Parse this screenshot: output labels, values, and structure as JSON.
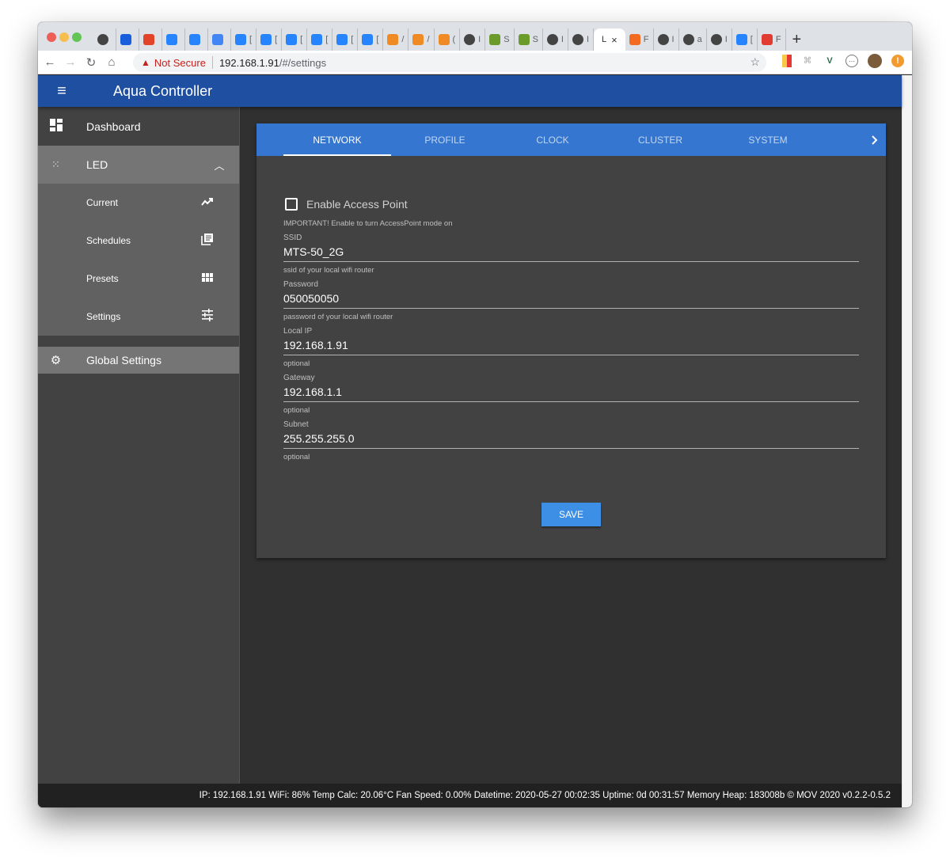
{
  "browser": {
    "tabs": [
      {
        "icon": "globe-icon",
        "label": "",
        "color": "#444444"
      },
      {
        "icon": "bitwarden-icon",
        "label": "",
        "color": "#175ddc"
      },
      {
        "icon": "gitlab-icon",
        "label": "",
        "color": "#e24329"
      },
      {
        "icon": "confluence-icon",
        "label": "",
        "color": "#2684ff"
      },
      {
        "icon": "jira-icon",
        "label": "",
        "color": "#2684ff"
      },
      {
        "icon": "translate-icon",
        "label": "",
        "color": "#4285f4"
      },
      {
        "icon": "jira-icon",
        "label": "[",
        "color": "#2684ff"
      },
      {
        "icon": "jira-icon",
        "label": "[",
        "color": "#2684ff"
      },
      {
        "icon": "jira-icon",
        "label": "[",
        "color": "#2684ff"
      },
      {
        "icon": "jira-icon",
        "label": "[",
        "color": "#2684ff"
      },
      {
        "icon": "jira-icon",
        "label": "[",
        "color": "#2684ff"
      },
      {
        "icon": "jira-icon",
        "label": "[",
        "color": "#2684ff"
      },
      {
        "icon": "box-icon",
        "label": "/",
        "color": "#f08a24"
      },
      {
        "icon": "box-icon",
        "label": "/",
        "color": "#f08a24"
      },
      {
        "icon": "box-icon",
        "label": "(",
        "color": "#f08a24"
      },
      {
        "icon": "globe-icon",
        "label": "I",
        "color": "#444444"
      },
      {
        "icon": "swagger-icon",
        "label": "S",
        "color": "#6b9b2a"
      },
      {
        "icon": "swagger-icon",
        "label": "S",
        "color": "#6b9b2a"
      },
      {
        "icon": "globe-icon",
        "label": "I",
        "color": "#444444"
      },
      {
        "icon": "globe-icon",
        "label": "I",
        "color": "#444444"
      },
      {
        "icon": "",
        "label": "L",
        "color": "",
        "active": true
      },
      {
        "icon": "app-icon",
        "label": "F",
        "color": "#f26b21"
      },
      {
        "icon": "globe-icon",
        "label": "I",
        "color": "#444444"
      },
      {
        "icon": "globe-icon",
        "label": "a",
        "color": "#444444"
      },
      {
        "icon": "globe-icon",
        "label": "I",
        "color": "#444444"
      },
      {
        "icon": "jira-icon",
        "label": "[",
        "color": "#2684ff"
      },
      {
        "icon": "sl-icon",
        "label": "F",
        "color": "#e03c31"
      }
    ],
    "new_tab": "+",
    "security_label": "Not Secure",
    "url_host": "192.168.1.91",
    "url_path": "/#/settings"
  },
  "app": {
    "title": "Aqua Controller"
  },
  "sidebar": {
    "dashboard": "Dashboard",
    "led": "LED",
    "led_items": [
      {
        "label": "Current",
        "icon": "trending-up-icon"
      },
      {
        "label": "Schedules",
        "icon": "library-books-icon"
      },
      {
        "label": "Presets",
        "icon": "grid-icon"
      },
      {
        "label": "Settings",
        "icon": "tune-icon"
      }
    ],
    "global_settings": "Global Settings"
  },
  "settings": {
    "tabs": [
      "NETWORK",
      "PROFILE",
      "CLOCK",
      "CLUSTER",
      "SYSTEM"
    ],
    "active_tab": "NETWORK",
    "enable_ap_label": "Enable Access Point",
    "enable_ap_checked": false,
    "enable_ap_hint": "IMPORTANT! Enable to turn AccessPoint mode on",
    "fields": [
      {
        "label": "SSID",
        "value": "MTS-50_2G",
        "hint": "ssid of your local wifi router"
      },
      {
        "label": "Password",
        "value": "050050050",
        "hint": "password of your local wifi router"
      },
      {
        "label": "Local IP",
        "value": "192.168.1.91",
        "hint": "optional"
      },
      {
        "label": "Gateway",
        "value": "192.168.1.1",
        "hint": "optional"
      },
      {
        "label": "Subnet",
        "value": "255.255.255.0",
        "hint": "optional"
      }
    ],
    "save_label": "SAVE"
  },
  "footer": {
    "text": "IP: 192.168.1.91 WiFi: 86% Temp Calc: 20.06°C Fan Speed: 0.00% Datetime: 2020-05-27 00:02:35 Uptime: 0d 00:31:57 Memory Heap: 183008b © MOV 2020 v0.2.2-0.5.2"
  }
}
